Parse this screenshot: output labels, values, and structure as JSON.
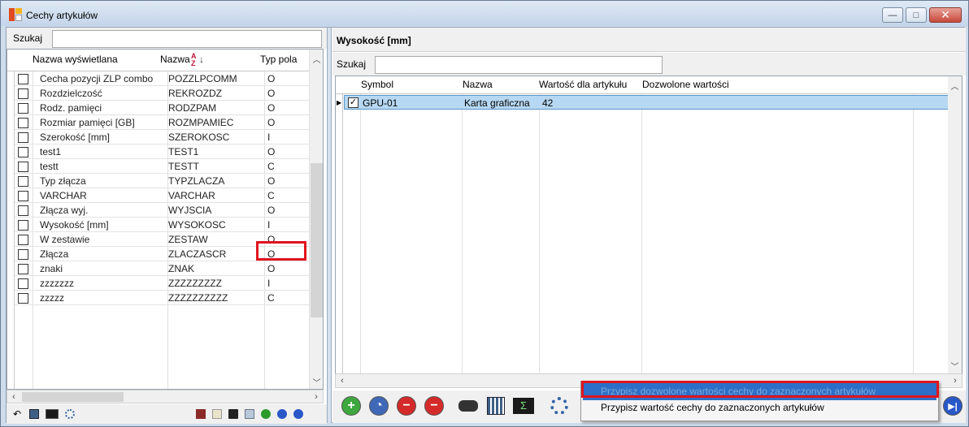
{
  "window": {
    "title": "Cechy artykułów",
    "buttons": {
      "minimize": "—",
      "maximize": "□",
      "close": "✕"
    }
  },
  "left": {
    "search_label": "Szukaj",
    "search_value": "",
    "columns": {
      "display_name": "Nazwa wyświetlana",
      "name": "Nazwa",
      "type": "Typ pola"
    },
    "sort_icon": "A↓Z",
    "rows": [
      {
        "display": "Cecha pozycji ZLP combo",
        "name": "POZZLPCOMM",
        "type": "O"
      },
      {
        "display": "Rozdzielczość",
        "name": "REKROZDZ",
        "type": "O"
      },
      {
        "display": "Rodz. pamięci",
        "name": "RODZPAM",
        "type": "O"
      },
      {
        "display": "Rozmiar pamięci [GB]",
        "name": "ROZMPAMIEC",
        "type": "O"
      },
      {
        "display": "Szerokość [mm]",
        "name": "SZEROKOSC",
        "type": "I"
      },
      {
        "display": "test1",
        "name": "TEST1",
        "type": "O"
      },
      {
        "display": "testt",
        "name": "TESTT",
        "type": "C"
      },
      {
        "display": "Typ złącza",
        "name": "TYPZLACZA",
        "type": "O"
      },
      {
        "display": "VARCHAR",
        "name": "VARCHAR",
        "type": "C"
      },
      {
        "display": "Złącza wyj.",
        "name": "WYJSCIA",
        "type": "O"
      },
      {
        "display": "Wysokość [mm]",
        "name": "WYSOKOSC",
        "type": "I"
      },
      {
        "display": "W zestawie",
        "name": "ZESTAW",
        "type": "O"
      },
      {
        "display": "Złącza",
        "name": "ZLACZASCR",
        "type": "O"
      },
      {
        "display": "znaki",
        "name": "ZNAK",
        "type": "O"
      },
      {
        "display": "zzzzzzz",
        "name": "ZZZZZZZZZ",
        "type": "I"
      },
      {
        "display": "zzzzz",
        "name": "ZZZZZZZZZZ",
        "type": "C"
      }
    ]
  },
  "right": {
    "title": "Wysokość [mm]",
    "search_label": "Szukaj",
    "search_value": "",
    "columns": {
      "symbol": "Symbol",
      "name": "Nazwa",
      "value": "Wartość dla artykułu",
      "allowed": "Dozwolone wartości"
    },
    "rows": [
      {
        "symbol": "GPU-01",
        "name": "Karta graficzna",
        "value": "42",
        "allowed": "",
        "checked": "✓"
      }
    ]
  },
  "context_menu": {
    "items": [
      {
        "label": "Przypisz dozwolone wartości cechy do zaznaczonych artykułów"
      },
      {
        "label": "Przypisz wartość cechy do zaznaczonych artykułów"
      }
    ]
  },
  "colors": {
    "highlight": "#e0141e",
    "selection": "#b7d8f2",
    "menu_selected": "#2d6fc8"
  }
}
